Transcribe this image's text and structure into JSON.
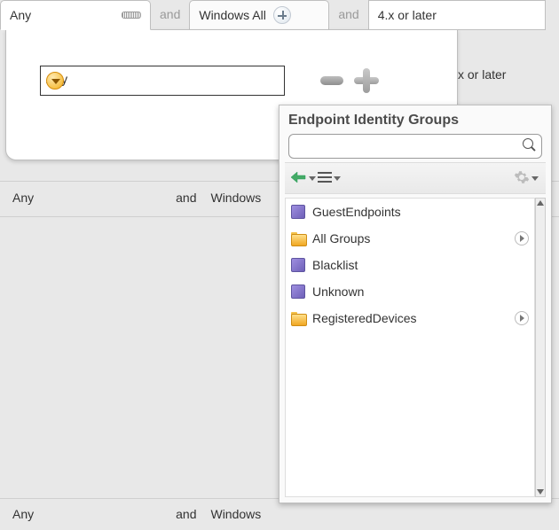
{
  "tabs": {
    "first": "Any",
    "second": "Windows All",
    "third": "4.x or later",
    "and": "and"
  },
  "panel": {
    "select_value": "Any",
    "under_text": "x or later"
  },
  "popup": {
    "title": "Endpoint Identity Groups",
    "search_placeholder": "",
    "items": [
      {
        "type": "cube",
        "label": "GuestEndpoints",
        "expandable": false
      },
      {
        "type": "folder",
        "label": "All Groups",
        "expandable": true
      },
      {
        "type": "cube",
        "label": "Blacklist",
        "expandable": false
      },
      {
        "type": "cube",
        "label": "Unknown",
        "expandable": false
      },
      {
        "type": "folder",
        "label": "RegisteredDevices",
        "expandable": true
      }
    ]
  },
  "bgrows": {
    "r1": {
      "v": "Any",
      "and": "and",
      "w": "Windows"
    },
    "r2": {
      "v": "Any",
      "and": "and",
      "w": "Windows"
    }
  }
}
